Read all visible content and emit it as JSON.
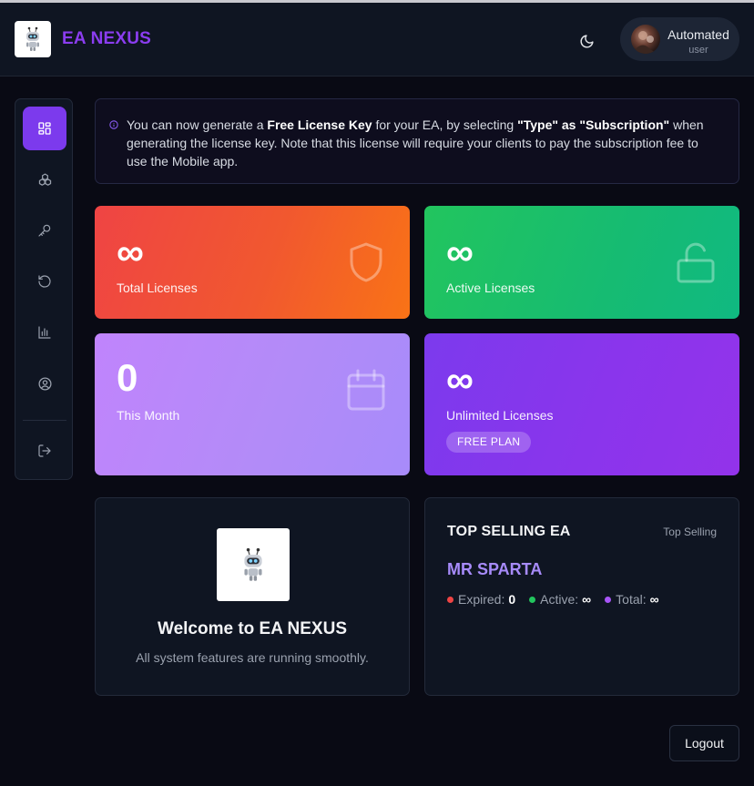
{
  "header": {
    "brand": "EA NEXUS",
    "user": {
      "name": "Automated",
      "role": "user"
    }
  },
  "sidebar": {
    "items": [
      {
        "icon": "dashboard-icon",
        "active": true
      },
      {
        "icon": "cubes-icon",
        "active": false
      },
      {
        "icon": "key-icon",
        "active": false
      },
      {
        "icon": "refresh-icon",
        "active": false
      },
      {
        "icon": "bar-chart-icon",
        "active": false
      },
      {
        "icon": "user-circle-icon",
        "active": false
      },
      {
        "icon": "logout-icon",
        "active": false
      }
    ]
  },
  "notice": {
    "text_1": "You can now generate a ",
    "bold_1": "Free License Key",
    "text_2": " for your EA, by selecting ",
    "bold_2": "\"Type\" as \"Subscription\"",
    "text_3": " when generating the license key. Note that this license will require your clients to pay the subscription fee to use the Mobile app."
  },
  "cards": {
    "total": {
      "value": "∞",
      "label": "Total Licenses",
      "icon": "shield-icon"
    },
    "active": {
      "value": "∞",
      "label": "Active Licenses",
      "icon": "unlock-icon"
    },
    "month": {
      "value": "0",
      "label": "This Month",
      "icon": "calendar-icon"
    },
    "unlimited": {
      "value": "∞",
      "label": "Unlimited Licenses",
      "badge": "FREE PLAN"
    }
  },
  "welcome": {
    "title": "Welcome to EA NEXUS",
    "subtitle": "All system features are running smoothly."
  },
  "top_selling": {
    "title": "TOP SELLING EA",
    "tag": "Top Selling",
    "ea_name": "MR SPARTA",
    "expired_label": "Expired:",
    "expired_value": "0",
    "active_label": "Active:",
    "active_value": "∞",
    "total_label": "Total:",
    "total_value": "∞"
  },
  "logout_label": "Logout",
  "colors": {
    "accent": "#7c3aed",
    "brand": "#8b3df0",
    "expired_dot": "#ef4444",
    "active_dot": "#22c55e",
    "total_dot": "#a855f7"
  }
}
